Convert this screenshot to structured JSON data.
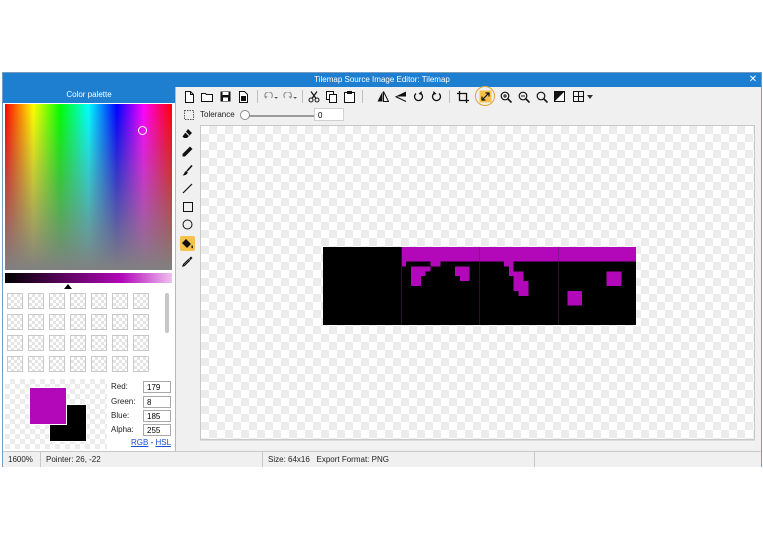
{
  "window": {
    "title": "Tilemap Source Image Editor: Tilemap",
    "close_glyph": "✕"
  },
  "palette": {
    "header": "Color palette",
    "primary_color": "#b308b9",
    "secondary_color": "#000000",
    "rgba": [
      {
        "label": "Red:",
        "value": "179"
      },
      {
        "label": "Green:",
        "value": "8"
      },
      {
        "label": "Blue:",
        "value": "185"
      },
      {
        "label": "Alpha:",
        "value": "255"
      }
    ],
    "mode_links": {
      "rgb": "RGB",
      "separator": " - ",
      "hsl": "HSL"
    }
  },
  "toolbar": {
    "buttons": [
      {
        "name": "new-file",
        "icon": "new-file-icon"
      },
      {
        "name": "open-folder",
        "icon": "folder-icon"
      },
      {
        "name": "save",
        "icon": "save-icon"
      },
      {
        "name": "save-as",
        "icon": "save-as-icon"
      },
      {
        "name": "undo",
        "icon": "undo-icon"
      },
      {
        "name": "redo",
        "icon": "redo-icon"
      },
      {
        "name": "cut",
        "icon": "scissors-icon"
      },
      {
        "name": "copy",
        "icon": "copy-icon"
      },
      {
        "name": "paste",
        "icon": "paste-icon"
      },
      {
        "name": "flip-horizontal",
        "icon": "flip-horizontal-icon"
      },
      {
        "name": "flip-vertical",
        "icon": "flip-vertical-icon"
      },
      {
        "name": "rotate-left",
        "icon": "rotate-left-icon"
      },
      {
        "name": "rotate-right",
        "icon": "rotate-right-icon"
      },
      {
        "name": "crop",
        "icon": "crop-icon"
      },
      {
        "name": "resize",
        "icon": "resize-icon"
      },
      {
        "name": "zoom-in",
        "icon": "zoom-in-icon"
      },
      {
        "name": "zoom-out",
        "icon": "zoom-out-icon"
      },
      {
        "name": "zoom-fit",
        "icon": "zoom-fit-icon"
      },
      {
        "name": "background-toggle",
        "icon": "contrast-icon"
      },
      {
        "name": "grid",
        "icon": "grid-icon"
      }
    ]
  },
  "tolerance": {
    "label": "Tolerance",
    "value": "0"
  },
  "tools": [
    {
      "name": "eraser",
      "icon": "eraser-icon"
    },
    {
      "name": "pencil",
      "icon": "pencil-icon"
    },
    {
      "name": "brush",
      "icon": "brush-icon"
    },
    {
      "name": "line",
      "icon": "line-icon"
    },
    {
      "name": "rectangle",
      "icon": "rectangle-icon"
    },
    {
      "name": "ellipse",
      "icon": "ellipse-icon"
    },
    {
      "name": "fill-bucket",
      "icon": "paint-bucket-icon",
      "active": true
    },
    {
      "name": "color-picker",
      "icon": "eyedropper-icon"
    }
  ],
  "image": {
    "background": "#000000",
    "accent": "#b308b9",
    "tile_divider": "#5a1a5e"
  },
  "status": {
    "zoom": "1600%",
    "pointer": "Pointer: 26, -22",
    "size": "Size: 64x16",
    "export_format": "Export Format: PNG"
  }
}
